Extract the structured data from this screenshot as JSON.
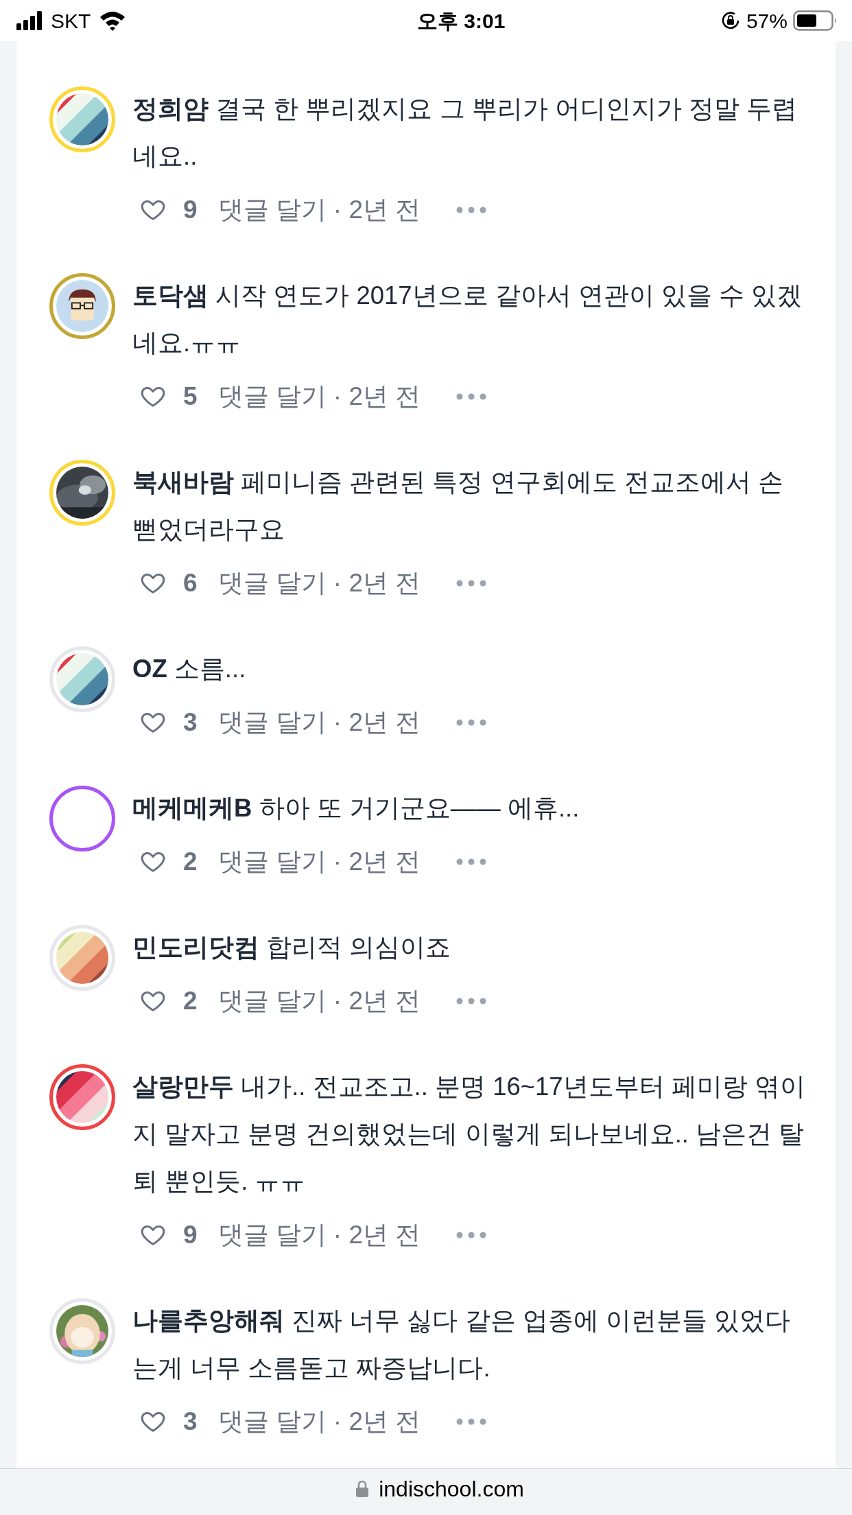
{
  "status_bar": {
    "carrier": "SKT",
    "time": "오후 3:01",
    "battery": "57%"
  },
  "comments": [
    {
      "author": "정희얌",
      "text": "결국 한 뿌리겠지요 그 뿌리가 어디인지가 정말 두렵네요..",
      "likes": "9",
      "reply": "댓글 달기",
      "time": "· 2년 전",
      "avatar": {
        "kind": "ocean",
        "color": "#fcd839"
      }
    },
    {
      "author": "토닥샘",
      "text": "시작 연도가 2017년으로 같아서 연관이 있을 수 있겠네요.ㅠㅠ",
      "likes": "5",
      "reply": "댓글 달기",
      "time": "· 2년 전",
      "avatar": {
        "kind": "cartoon",
        "color": "#c4a635"
      }
    },
    {
      "author": "북새바람",
      "text": "페미니즘 관련된 특정 연구회에도 전교조에서 손 뻗었더라구요",
      "likes": "6",
      "reply": "댓글 달기",
      "time": "· 2년 전"
    },
    {
      "author": "OZ",
      "text": "소름...",
      "likes": "3",
      "reply": "댓글 달기",
      "time": "· 2년 전",
      "avatar": {
        "kind": "ocean",
        "color": "#e5e7eb"
      }
    },
    {
      "author": "메케메케B",
      "text": "하아 또 거기군요—— 에휴...",
      "likes": "2",
      "reply": "댓글 달기",
      "time": "· 2년 전",
      "avatar": {
        "kind": "empty",
        "color": "#a855f7"
      }
    },
    {
      "author": "민도리닷컴",
      "text": "합리적 의심이죠",
      "likes": "2",
      "reply": "댓글 달기",
      "time": "· 2년 전",
      "avatar": {
        "kind": "autumn",
        "color": "#e5e7eb"
      }
    },
    {
      "author": "살랑만두",
      "text": "내가.. 전교조고.. 분명 16~17년도부터 페미랑 엮이지 말자고 분명 건의했었는데 이렇게 되나보네요.. 남은건 탈퇴 뿐인듯. ㅠㅠ",
      "likes": "9",
      "reply": "댓글 달기",
      "time": "· 2년 전",
      "avatar": {
        "kind": "berry",
        "color": "#ef4444"
      }
    },
    {
      "author": "나를추앙해줘",
      "text": "진짜 너무 싫다 같은 업종에 이런분들 있었다는게 너무 소름돋고 짜증납니다.",
      "likes": "3",
      "reply": "댓글 달기",
      "time": "· 2년 전"
    }
  ],
  "address_bar": {
    "url": "indischool.com"
  }
}
